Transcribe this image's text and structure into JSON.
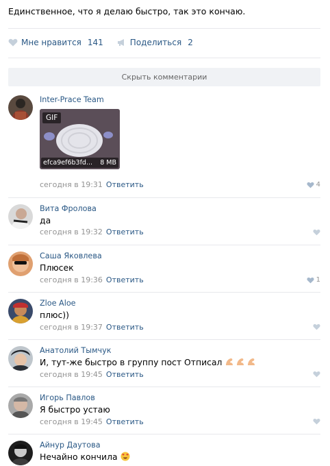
{
  "post": {
    "text": "Единственное, что я делаю быстро, так это кончаю.",
    "like_label": "Мне нравится",
    "like_count": "141",
    "share_label": "Поделиться",
    "share_count": "2"
  },
  "hide_comments_label": "Скрыть комментарии",
  "reply_label": "Ответить",
  "comments": [
    {
      "author": "Inter-Prace Team",
      "text": "",
      "time": "сегодня в 19:31",
      "likes": "4",
      "gif": {
        "badge": "GIF",
        "name": "efca9ef6b3fd...",
        "size": "8 MB"
      }
    },
    {
      "author": "Вита Фролова",
      "text": "да",
      "time": "сегодня в 19:32",
      "likes": ""
    },
    {
      "author": "Саша Яковлева",
      "text": "Плюсек",
      "time": "сегодня в 19:36",
      "likes": "1"
    },
    {
      "author": "Zloe Aloe",
      "text": "плюс))",
      "time": "сегодня в 19:37",
      "likes": ""
    },
    {
      "author": "Анатолий Тымчук",
      "text": "И, тут-же быстро в группу пост Отписал",
      "time": "сегодня в 19:45",
      "likes": "",
      "emoji": "muscle-x3"
    },
    {
      "author": "Игорь Павлов",
      "text": "Я быстро устаю",
      "time": "сегодня в 19:45",
      "likes": ""
    },
    {
      "author": "Айнур Даутова",
      "text": "Нечайно кончила",
      "time": "",
      "likes": "",
      "emoji": "heart-eyes"
    }
  ],
  "colors": {
    "link": "#2a5885",
    "meta": "#939393",
    "divider": "#e7e8ec",
    "button_bg": "#f0f2f5"
  }
}
